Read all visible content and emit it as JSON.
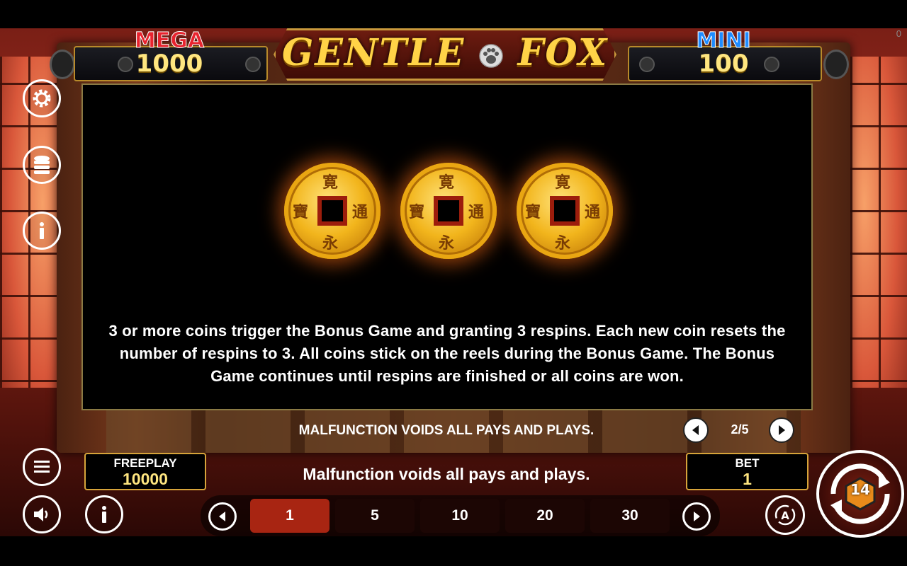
{
  "game": {
    "logo_text_left": "GENTLE",
    "logo_text_right": "FOX"
  },
  "jackpots": {
    "mega_label": "MEGA",
    "mega_value": "1000",
    "mini_label": "MINI",
    "mini_value": "100"
  },
  "corner_counter": "0",
  "info_panel": {
    "description": "3 or more coins trigger the Bonus Game and granting 3 respins. Each new coin resets the number of respins to 3. All coins stick on the reels during the Bonus Game. The Bonus Game continues until respins are finished or all coins are won.",
    "coin_chars": {
      "top": "寛",
      "bottom": "永",
      "left": "寶",
      "right": "通"
    },
    "footer_notice": "MALFUNCTION VOIDS ALL PAYS AND PLAYS.",
    "page_indicator": "2/5"
  },
  "bottom_bar": {
    "freeplay_label": "FREEPLAY",
    "freeplay_value": "10000",
    "notice": "Malfunction voids all pays and plays.",
    "bet_label": "BET",
    "bet_value": "1",
    "bet_options": [
      "1",
      "5",
      "10",
      "20",
      "30"
    ],
    "selected_bet": "1",
    "spin_badge": "14"
  },
  "colors": {
    "mega": "#e8232e",
    "mini": "#1e8cff",
    "gold": "#ffd347",
    "selected_bet": "#a82512"
  },
  "icons": [
    "gear-icon",
    "coins-stack-icon",
    "info-icon",
    "menu-icon",
    "speaker-icon",
    "info-icon",
    "arrow-left-icon",
    "arrow-right-icon",
    "autoplay-icon",
    "spin-icon",
    "paw-icon"
  ]
}
